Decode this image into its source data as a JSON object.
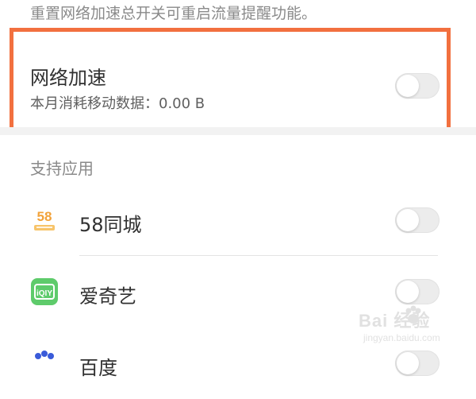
{
  "top_note": "重置网络加速总开关可重启流量提醒功能。",
  "accelerate": {
    "title": "网络加速",
    "subtitle": "本月消耗移动数据：0.00 B",
    "enabled": false
  },
  "section_label": "支持应用",
  "apps": [
    {
      "name": "58同城",
      "icon": "58-tongcheng-icon",
      "icon_text": "58",
      "enabled": false
    },
    {
      "name": "爱奇艺",
      "icon": "iqiyi-icon",
      "icon_text": "iQIY",
      "icon_color": "#5ecb6b",
      "enabled": false
    },
    {
      "name": "百度",
      "icon": "baidu-app-icon",
      "enabled": false
    }
  ],
  "colors": {
    "highlight_border": "#f2703f",
    "toggle_off": "#ececec"
  },
  "watermark": {
    "text": "Bai 经验",
    "sub": "jingyan.baidu.com"
  }
}
